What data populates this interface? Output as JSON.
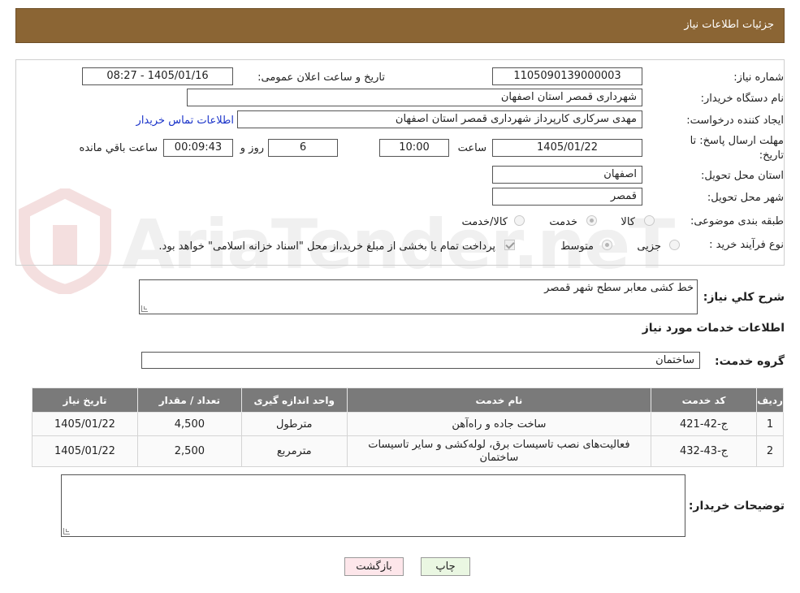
{
  "header": {
    "title": "جزئیات اطلاعات نیاز"
  },
  "form": {
    "need_number_label": "شماره نیاز:",
    "need_number": "1105090139000003",
    "announce_label": "تاریخ و ساعت اعلان عمومی:",
    "announce_value": "1405/01/16 - 08:27",
    "buyer_label": "نام دستگاه خریدار:",
    "buyer_value": "شهرداری قمصر استان اصفهان",
    "creator_label": "ایجاد کننده درخواست:",
    "creator_value": "مهدی سرکاری کارپرداز شهرداری قمصر استان اصفهان",
    "contact_link": "اطلاعات تماس خریدار",
    "deadline_label_1": "مهلت ارسال پاسخ: تا",
    "deadline_label_2": "تاریخ:",
    "deadline_date": "1405/01/22",
    "time_label": "ساعت",
    "deadline_time": "10:00",
    "days_value": "6",
    "days_label": "روز و",
    "remaining_time": "00:09:43",
    "remaining_label": "ساعت باقي مانده",
    "province_label": "استان محل تحویل:",
    "province_value": "اصفهان",
    "city_label": "شهر محل تحویل:",
    "city_value": "قمصر",
    "category_label": "طبقه بندی موضوعی:",
    "category_options": [
      "کالا",
      "خدمت",
      "کالا/خدمت"
    ],
    "category_selected": "خدمت",
    "process_label": "نوع فرآیند خرید :",
    "process_options": [
      "جزیی",
      "متوسط"
    ],
    "process_selected": "متوسط",
    "payment_note": "پرداخت تمام یا بخشی از مبلغ خرید،از محل \"اسناد خزانه اسلامی\" خواهد بود."
  },
  "description": {
    "label": "شرح کلي نياز:",
    "value": "خط کشی معابر سطح شهر قمصر"
  },
  "services": {
    "section_title": "اطلاعات خدمات مورد نياز",
    "group_label": "گروه خدمت:",
    "group_value": "ساختمان",
    "columns": [
      "رديف",
      "کد خدمت",
      "نام خدمت",
      "واحد اندازه گيری",
      "تعداد / مقدار",
      "تاريخ نياز"
    ],
    "rows": [
      {
        "index": "1",
        "code": "ج-42-421",
        "name": "ساخت جاده و راه‌آهن",
        "unit": "مترطول",
        "qty": "4,500",
        "date": "1405/01/22"
      },
      {
        "index": "2",
        "code": "ج-43-432",
        "name": "فعالیت‌های نصب تاسیسات برق، لوله‌کشی و سایر تاسیسات ساختمان",
        "unit": "مترمربع",
        "qty": "2,500",
        "date": "1405/01/22"
      }
    ]
  },
  "buyer_notes": {
    "label": "توضيحات خريدار:",
    "value": ""
  },
  "buttons": {
    "print": "چاپ",
    "back": "بازگشت"
  },
  "colors": {
    "header_bg": "#8b6534",
    "table_header_bg": "#7a7a7a",
    "back_button_bg": "#fde6ea",
    "print_button_bg": "#eaf7e2",
    "link": "#1a33c9"
  },
  "watermark": "AriaTender.neT"
}
